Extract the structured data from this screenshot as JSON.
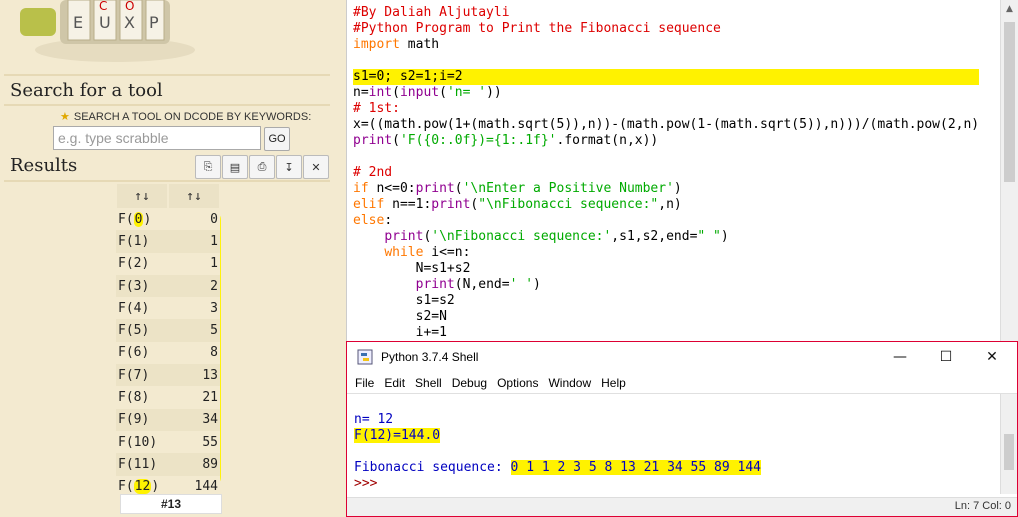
{
  "dcode": {
    "search_title": "Search for a tool",
    "keyword_label": "SEARCH A TOOL ON DCODE BY KEYWORDS:",
    "search_placeholder": "e.g. type scrabble",
    "go_label": "GO",
    "results_title": "Results",
    "toolbar_icons": [
      "copy-icon",
      "save-icon",
      "print-icon",
      "pin-icon",
      "close-icon"
    ],
    "table_headers": [
      "↑↓",
      "↑↓"
    ],
    "rows": [
      {
        "label_pre": "F(",
        "label_n": "0",
        "label_post": ")",
        "value": "0",
        "hl": true
      },
      {
        "label_pre": "F(",
        "label_n": "1",
        "label_post": ")",
        "value": "1",
        "hl": false
      },
      {
        "label_pre": "F(",
        "label_n": "2",
        "label_post": ")",
        "value": "1",
        "hl": false
      },
      {
        "label_pre": "F(",
        "label_n": "3",
        "label_post": ")",
        "value": "2",
        "hl": false
      },
      {
        "label_pre": "F(",
        "label_n": "4",
        "label_post": ")",
        "value": "3",
        "hl": false
      },
      {
        "label_pre": "F(",
        "label_n": "5",
        "label_post": ")",
        "value": "5",
        "hl": false
      },
      {
        "label_pre": "F(",
        "label_n": "6",
        "label_post": ")",
        "value": "8",
        "hl": false
      },
      {
        "label_pre": "F(",
        "label_n": "7",
        "label_post": ")",
        "value": "13",
        "hl": false
      },
      {
        "label_pre": "F(",
        "label_n": "8",
        "label_post": ")",
        "value": "21",
        "hl": false
      },
      {
        "label_pre": "F(",
        "label_n": "9",
        "label_post": ")",
        "value": "34",
        "hl": false
      },
      {
        "label_pre": "F(",
        "label_n": "10",
        "label_post": ")",
        "value": "55",
        "hl": false
      },
      {
        "label_pre": "F(",
        "label_n": "11",
        "label_post": ")",
        "value": "89",
        "hl": false
      },
      {
        "label_pre": "F(",
        "label_n": "12",
        "label_post": ")",
        "value": "144",
        "hl": true
      }
    ],
    "result_count": "#13"
  },
  "editor": {
    "lines": [
      "#By Daliah Aljutayli",
      "#Python Program to Print the Fibonacci sequence",
      "import math",
      "",
      "s1=0; s2=1;i=2",
      "n=int(input('n= '))",
      "# 1st:",
      "x=((math.pow(1+(math.sqrt(5)),n))-(math.pow(1-(math.sqrt(5)),n)))/(math.pow(2,n)",
      "print('F({0:.0f})={1:.1f}'.format(n,x))",
      "",
      "# 2nd",
      "if n<=0:print('\\nEnter a Positive Number')",
      "elif n==1:print(\"\\nFibonacci sequence:\",n)",
      "else:",
      "    print('\\nFibonacci sequence:',s1,s2,end=\" \")",
      "    while i<=n:",
      "        N=s1+s2",
      "        print(N,end=' ')",
      "        s1=s2",
      "        s2=N",
      "        i+=1"
    ]
  },
  "shell": {
    "title": "Python 3.7.4 Shell",
    "controls": [
      "—",
      "☐",
      "✕"
    ],
    "menu": [
      "File",
      "Edit",
      "Shell",
      "Debug",
      "Options",
      "Window",
      "Help"
    ],
    "prompt_line": "n= 12",
    "result_line": "F(12)=144.0",
    "seq_label": "Fibonacci sequence:",
    "seq_values": "0 1 1 2 3 5 8 13 21 34 55 89 144",
    "prompt": ">>>",
    "status": "Ln: 7   Col: 0"
  }
}
